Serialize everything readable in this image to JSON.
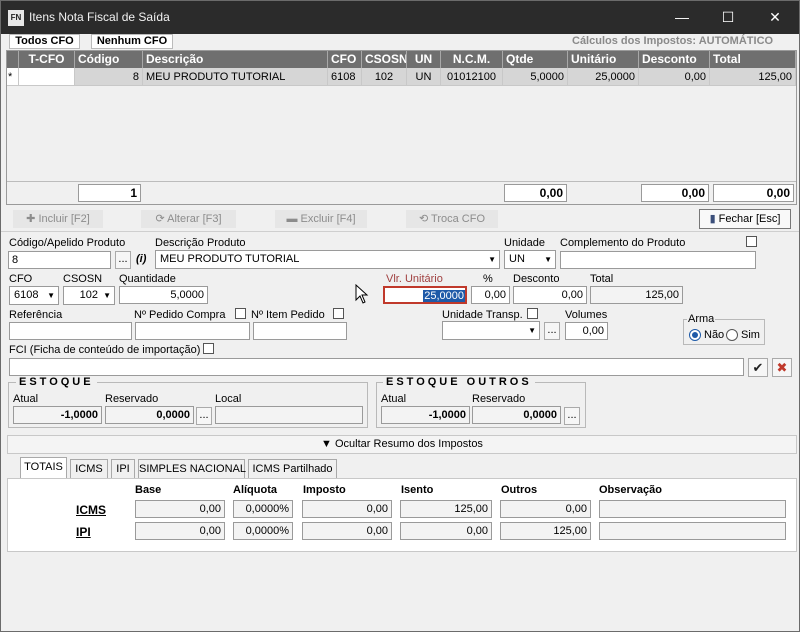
{
  "window": {
    "title": "Itens Nota Fiscal de Saída",
    "app_icon": "FN",
    "minimize": "—",
    "maximize": "☐",
    "close": "✕"
  },
  "top_tabs": {
    "todos": "Todos CFO",
    "nenhum": "Nenhum CFO",
    "calc_status": "Cálculos dos Impostos: AUTOMÁTICO"
  },
  "grid": {
    "headers": [
      "T-CFO",
      "Código",
      "Descrição",
      "CFO",
      "CSOSN",
      "UN",
      "N.C.M.",
      "Qtde",
      "Unitário",
      "Desconto",
      "Total"
    ],
    "row": {
      "marker": "*",
      "tcfo": "",
      "codigo": "8",
      "descricao": "MEU PRODUTO TUTORIAL",
      "cfo": "6108",
      "csosn": "102",
      "un": "UN",
      "ncm": "01012100",
      "qtde": "5,0000",
      "unitario": "25,0000",
      "desconto": "0,00",
      "total": "125,00"
    },
    "footer": {
      "count": "1",
      "qtde": "0,00",
      "desconto": "0,00",
      "total": "0,00"
    }
  },
  "toolbar": {
    "incluir": "Incluir [F2]",
    "alterar": "Alterar [F3]",
    "excluir": "Excluir [F4]",
    "troca": "Troca CFO",
    "fechar": "Fechar [Esc]"
  },
  "form": {
    "codigo_label": "Código/Apelido Produto",
    "codigo_value": "8",
    "ellipsis": "...",
    "info": "(i)",
    "descricao_label": "Descrição Produto",
    "descricao_value": "MEU PRODUTO TUTORIAL",
    "unidade_label": "Unidade",
    "unidade_value": "UN",
    "complemento_label": "Complemento do Produto",
    "cfo_label": "CFO",
    "cfo_value": "6108",
    "csosn_label": "CSOSN",
    "csosn_value": "102",
    "quantidade_label": "Quantidade",
    "quantidade_value": "5,0000",
    "vlr_unit_label": "Vlr. Unitário",
    "vlr_unit_value": "25,0000",
    "pct_label": "%",
    "pct_value": "0,00",
    "desconto_label": "Desconto",
    "desconto_value": "0,00",
    "total_label": "Total",
    "total_value": "125,00",
    "referencia_label": "Referência",
    "pedido_label": "Nº Pedido Compra",
    "item_pedido_label": "Nº Item Pedido",
    "unid_transp_label": "Unidade Transp.",
    "volumes_label": "Volumes",
    "volumes_value": "0,00",
    "arma_label": "Arma",
    "arma_nao": "Não",
    "arma_sim": "Sim",
    "fci_label": "FCI (Ficha de conteúdo de importação)",
    "confirm_icon": "✔",
    "cancel_icon": "✖"
  },
  "estoque": {
    "title": "ESTOQUE",
    "atual_label": "Atual",
    "atual_value": "-1,0000",
    "reservado_label": "Reservado",
    "reservado_value": "0,0000",
    "local_label": "Local"
  },
  "estoque_outros": {
    "title": "ESTOQUE OUTROS",
    "atual_label": "Atual",
    "atual_value": "-1,0000",
    "reservado_label": "Reservado",
    "reservado_value": "0,0000"
  },
  "resumo_toggle": "▼  Ocultar Resumo dos Impostos",
  "tax_tabs": [
    "TOTAIS",
    "ICMS",
    "IPI",
    "SIMPLES NACIONAL",
    "ICMS Partilhado"
  ],
  "tax_table": {
    "headers": {
      "base": "Base",
      "aliquota": "Alíquota",
      "imposto": "Imposto",
      "isento": "Isento",
      "outros": "Outros",
      "observacao": "Observação"
    },
    "rows": [
      {
        "name": "ICMS",
        "base": "0,00",
        "aliquota": "0,0000%",
        "imposto": "0,00",
        "isento": "125,00",
        "outros": "0,00",
        "observacao": ""
      },
      {
        "name": "IPI",
        "base": "0,00",
        "aliquota": "0,0000%",
        "imposto": "0,00",
        "isento": "0,00",
        "outros": "125,00",
        "observacao": ""
      }
    ]
  }
}
